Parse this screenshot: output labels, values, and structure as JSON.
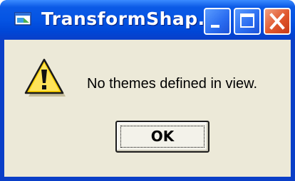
{
  "window": {
    "title": "TransformShap...",
    "app_icon": "window-app-icon",
    "controls": {
      "minimize_icon": "minimize-icon",
      "maximize_icon": "maximize-icon",
      "close_icon": "close-icon"
    }
  },
  "dialog": {
    "icon": "warning-icon",
    "message": "No themes defined in view.",
    "ok_label": "OK"
  },
  "colors": {
    "titlebar": "#0554e3",
    "client_background": "#ece9d8",
    "close_button": "#e0562c",
    "warning_yellow": "#ffd200"
  }
}
